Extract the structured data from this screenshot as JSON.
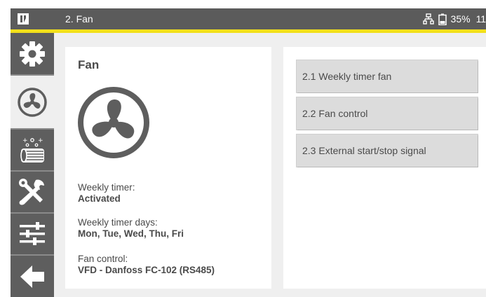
{
  "header": {
    "title": "2. Fan",
    "battery": "35%",
    "time": "11:",
    "logo_icon": "app-logo-icon",
    "network_icon": "network-icon",
    "battery_icon": "battery-icon"
  },
  "colors": {
    "topbar": "#5b5b5b",
    "accent": "#f2e01a",
    "sidebar_dark": "#5e5e5e",
    "background": "#efefef",
    "button": "#dcdcdc",
    "text": "#4a4a4a"
  },
  "sidebar": {
    "items": [
      {
        "icon": "gear-icon",
        "active": false
      },
      {
        "icon": "fan-icon",
        "active": true
      },
      {
        "icon": "filter-icon",
        "active": false
      },
      {
        "icon": "tools-icon",
        "active": false
      },
      {
        "icon": "sliders-icon",
        "active": false
      },
      {
        "icon": "back-arrow-icon",
        "active": false
      }
    ]
  },
  "left_card": {
    "title": "Fan",
    "icon": "fan-icon",
    "weekly_timer_label": "Weekly timer:",
    "weekly_timer_value": "Activated",
    "weekly_days_label": "Weekly timer days:",
    "weekly_days_value": "Mon, Tue, Wed, Thu, Fri",
    "fan_control_label": "Fan control:",
    "fan_control_value": "VFD - Danfoss FC-102 (RS485)"
  },
  "right_card": {
    "buttons": [
      "2.1 Weekly timer fan",
      "2.2 Fan control",
      "2.3 External start/stop signal"
    ]
  }
}
